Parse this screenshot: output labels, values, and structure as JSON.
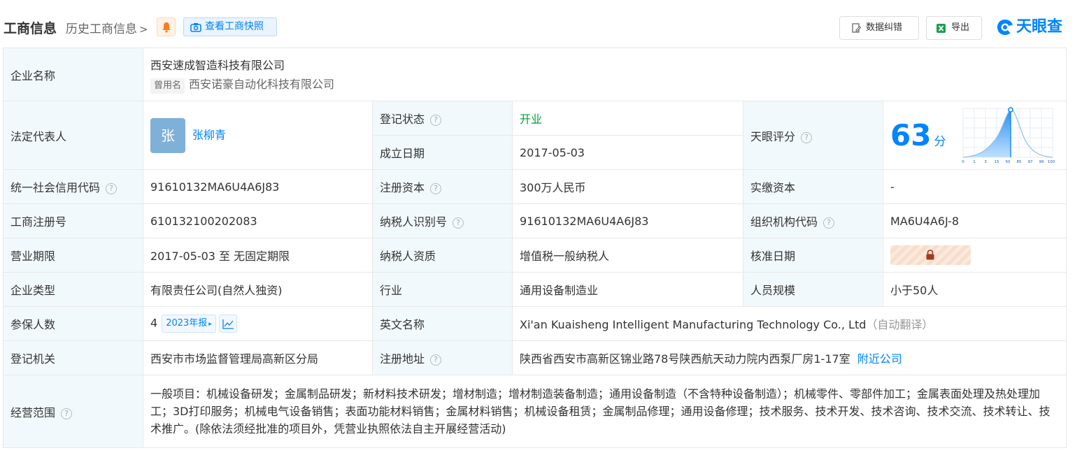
{
  "header": {
    "title": "工商信息",
    "history_link": "历史工商信息",
    "snapshot_button": "查看工商快照",
    "correct_button": "数据纠错",
    "export_button": "导出",
    "brand": "天眼查"
  },
  "company": {
    "name_label": "企业名称",
    "name": "西安速成智造科技有限公司",
    "former_name_tag": "曾用名",
    "former_name": "西安诺豪自动化科技有限公司"
  },
  "legal_rep": {
    "label": "法定代表人",
    "avatar_char": "张",
    "name": "张柳青"
  },
  "reg_status": {
    "label": "登记状态",
    "value": "开业"
  },
  "found_date": {
    "label": "成立日期",
    "value": "2017-05-03"
  },
  "tianyan_score": {
    "label": "天眼评分",
    "score": "63",
    "unit": "分",
    "axis_ticks": [
      "0",
      "1",
      "3",
      "15",
      "50",
      "85",
      "97",
      "99",
      "100"
    ]
  },
  "credit_code": {
    "label": "统一社会信用代码",
    "value": "91610132MA6U4A6J83"
  },
  "reg_capital": {
    "label": "注册资本",
    "value": "300万人民币"
  },
  "paid_capital": {
    "label": "实缴资本",
    "value": "-"
  },
  "reg_number": {
    "label": "工商注册号",
    "value": "610132100202083"
  },
  "tax_id": {
    "label": "纳税人识别号",
    "value": "91610132MA6U4A6J83"
  },
  "org_code": {
    "label": "组织机构代码",
    "value": "MA6U4A6J-8"
  },
  "business_term": {
    "label": "营业期限",
    "value": "2017-05-03 至 无固定期限"
  },
  "tax_qual": {
    "label": "纳税人资质",
    "value": "增值税一般纳税人"
  },
  "approve_date": {
    "label": "核准日期"
  },
  "company_type": {
    "label": "企业类型",
    "value": "有限责任公司(自然人独资)"
  },
  "industry": {
    "label": "行业",
    "value": "通用设备制造业"
  },
  "staff_size": {
    "label": "人员规模",
    "value": "小于50人"
  },
  "insured": {
    "label": "参保人数",
    "value": "4",
    "year_report": "2023年报"
  },
  "english_name": {
    "label": "英文名称",
    "value": "Xi'an Kuaisheng Intelligent Manufacturing Technology Co., Ltd",
    "note": "（自动翻译）"
  },
  "reg_authority": {
    "label": "登记机关",
    "value": "西安市市场监督管理局高新区分局"
  },
  "reg_address": {
    "label": "注册地址",
    "value": "陕西省西安市高新区锦业路78号陕西航天动力院内西泵厂房1-17室",
    "nearby": "附近公司"
  },
  "scope": {
    "label": "经营范围",
    "value": "一般项目：机械设备研发；金属制品研发；新材料技术研发；增材制造；增材制造装备制造；通用设备制造（不含特种设备制造）；机械零件、零部件加工；金属表面处理及热处理加工；3D打印服务；机械电气设备销售；表面功能材料销售；金属材料销售；机械设备租赁；金属制品修理；通用设备修理；技术服务、技术开发、技术咨询、技术交流、技术转让、技术推广。(除依法须经批准的项目外，凭营业执照依法自主开展经营活动)"
  },
  "colors": {
    "accent": "#0084ff",
    "label_bg": "#f2f9fc",
    "status_green": "#00a038"
  }
}
